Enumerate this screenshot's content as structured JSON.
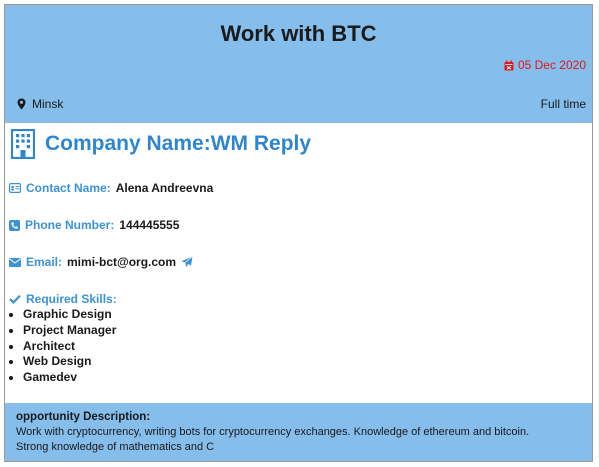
{
  "job": {
    "title": "Work with BTC",
    "date": "05 Dec 2020",
    "location": "Minsk",
    "type": "Full time"
  },
  "company": {
    "name": "Company Name:WM Reply"
  },
  "contact": {
    "name_label": "Contact Name:",
    "name_value": "Alena Andreevna",
    "phone_label": "Phone Number:",
    "phone_value": "144445555",
    "email_label": "Email:",
    "email_value": "mimi-bct@org.com"
  },
  "skills": {
    "title": "Required Skills:",
    "items": [
      "Graphic Design",
      "Project Manager",
      "Architect",
      "Web Design",
      "Gamedev"
    ]
  },
  "description": {
    "title": "opportunity Description:",
    "text": "Work with cryptocurrency, writing bots for cryptocurrency exchanges. Knowledge of ethereum and bitcoin. Strong knowledge of mathematics and C"
  },
  "colors": {
    "header_bg": "#85bdeb",
    "accent_blue": "#2f86cf",
    "date_red": "#e0191b"
  },
  "icons": {
    "date": "calendar-icon",
    "location": "map-marker-icon",
    "company": "building-icon",
    "contact": "id-card-icon",
    "phone": "phone-icon",
    "email": "envelope-icon",
    "send": "paper-plane-icon",
    "skills": "check-icon"
  }
}
